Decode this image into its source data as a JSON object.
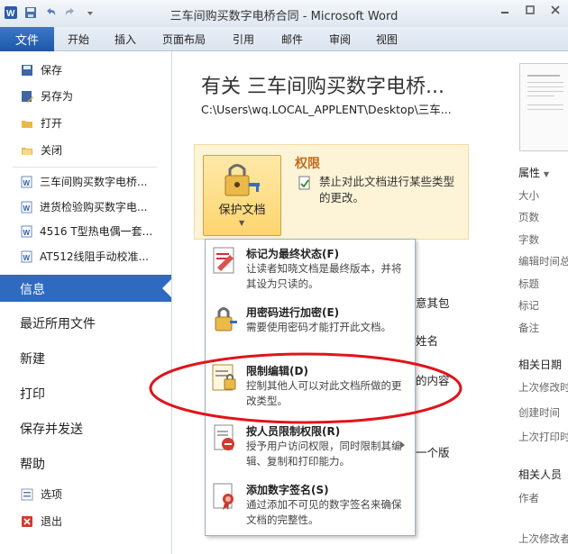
{
  "window": {
    "title": "三车间购买数字电桥合同 - Microsoft Word",
    "controls": [
      "minimize-icon",
      "maximize-icon",
      "close-icon"
    ]
  },
  "ribbon": {
    "file_tab": "文件",
    "tabs": [
      "开始",
      "插入",
      "页面布局",
      "引用",
      "邮件",
      "审阅",
      "视图"
    ]
  },
  "backstage": {
    "commands": [
      {
        "label": "保存",
        "icon": "save-icon"
      },
      {
        "label": "另存为",
        "icon": "save-as-icon"
      },
      {
        "label": "打开",
        "icon": "open-folder-icon"
      },
      {
        "label": "关闭",
        "icon": "close-document-icon"
      }
    ],
    "recent_docs": [
      "三车间购买数字电桥...",
      "进货检验购买数字电...",
      "4516 T型热电偶一套...",
      "AT512线阻手动校准..."
    ],
    "nav": {
      "info": "信息",
      "recent": "最近所用文件",
      "new": "新建",
      "print": "打印",
      "save_send": "保存并发送",
      "help": "帮助",
      "options": "选项",
      "exit": "退出"
    }
  },
  "info": {
    "title": "有关 三车间购买数字电桥...",
    "path": "C:\\Users\\wq.LOCAL_APPLENT\\Desktop\\三车...",
    "permissions": {
      "button_label": "保护文档",
      "heading": "权限",
      "description": "禁止对此文档进行某些类型的更改。"
    },
    "behind_fragments": [
      "意其包",
      "姓名",
      "的内容",
      "一个版"
    ]
  },
  "protect_menu": {
    "items": [
      {
        "title": "标记为最终状态(F)",
        "desc": "让读者知晓文档是最终版本，并将其设为只读的。",
        "icon": "mark-final-icon"
      },
      {
        "title": "用密码进行加密(E)",
        "desc": "需要使用密码才能打开此文档。",
        "icon": "encrypt-lock-icon"
      },
      {
        "title": "限制编辑(D)",
        "desc": "控制其他人可以对此文档所做的更改类型。",
        "icon": "restrict-editing-icon"
      },
      {
        "title": "按人员限制权限(R)",
        "desc": "授予用户访问权限，同时限制其编辑、复制和打印能力。",
        "icon": "restrict-people-icon"
      },
      {
        "title": "添加数字签名(S)",
        "desc": "通过添加不可见的数字签名来确保文档的完整性。",
        "icon": "digital-signature-icon"
      }
    ],
    "highlighted_index": 2
  },
  "properties_pane": {
    "heading": "属性",
    "fields": [
      "大小",
      "页数",
      "字数",
      "编辑时间总计",
      "标题",
      "标记",
      "备注"
    ],
    "dates_heading": "相关日期",
    "date_fields": [
      "上次修改时间",
      "创建时间",
      "上次打印时间"
    ],
    "people_heading": "相关人员",
    "people_fields": [
      "作者",
      "上次修改者"
    ]
  },
  "colors": {
    "file_tab": "#1f57a8",
    "selected_nav": "#2e6bc0",
    "permissions_bg": "#fdf4d7",
    "permissions_title": "#c36b1c",
    "annotation_ellipse": "#e0141b"
  }
}
